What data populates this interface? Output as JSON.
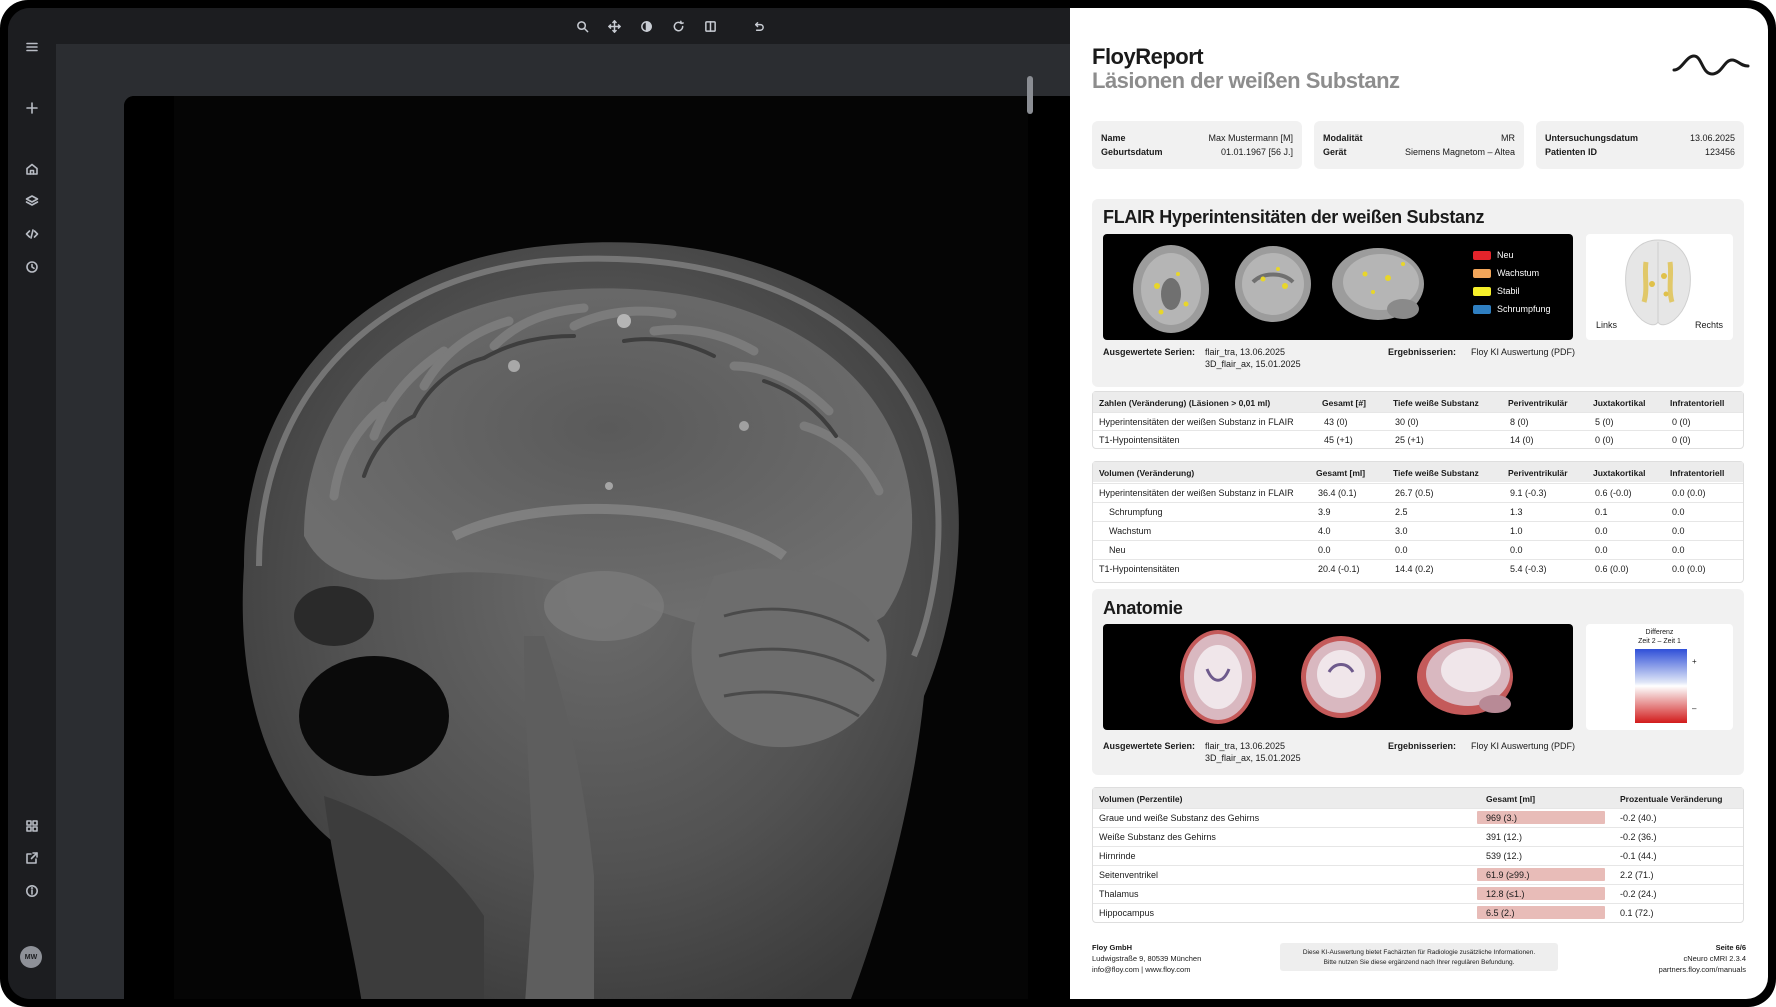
{
  "user": {
    "initials": "MW"
  },
  "viewer": {
    "tools": [
      "search-icon",
      "move-icon",
      "contrast-icon",
      "rotate-icon",
      "split-view-icon",
      "undo-icon"
    ]
  },
  "report": {
    "title": "FloyReport",
    "subtitle": "Läsionen der weißen Substanz",
    "patient": {
      "name_label": "Name",
      "name_value": "Max Mustermann [M]",
      "dob_label": "Geburtsdatum",
      "dob_value": "01.01.1967 [56 J.]",
      "modality_label": "Modalität",
      "modality_value": "MR",
      "device_label": "Gerät",
      "device_value": "Siemens Magnetom – Altea",
      "date_label": "Untersuchungsdatum",
      "date_value": "13.06.2025",
      "id_label": "Patienten ID",
      "id_value": "123456"
    },
    "flair": {
      "title": "FLAIR Hyperintensitäten der weißen Substanz",
      "legend": [
        {
          "label": "Neu",
          "color": "#e3242b"
        },
        {
          "label": "Wachstum",
          "color": "#f2a65a"
        },
        {
          "label": "Stabil",
          "color": "#f5ef2a"
        },
        {
          "label": "Schrumpfung",
          "color": "#2f7fc1"
        }
      ],
      "left_label": "Links",
      "right_label": "Rechts",
      "series_label": "Ausgewertete Serien:",
      "series_line1": "flair_tra, 13.06.2025",
      "series_line2": "3D_flair_ax, 15.01.2025",
      "results_label": "Ergebnisserien:",
      "results_value": "Floy KI Auswertung (PDF)"
    },
    "counts_table": {
      "headers": [
        "Zahlen (Veränderung) (Läsionen > 0,01 ml)",
        "Gesamt [#]",
        "Tiefe weiße Substanz",
        "Periventrikulär",
        "Juxtakortikal",
        "Infratentoriell"
      ],
      "rows": [
        [
          "Hyperintensitäten der weißen Substanz in FLAIR",
          "43 (0)",
          "30 (0)",
          "8 (0)",
          "5 (0)",
          "0 (0)"
        ],
        [
          "T1-Hypointensitäten",
          "45 (+1)",
          "25 (+1)",
          "14 (0)",
          "0 (0)",
          "0 (0)"
        ]
      ]
    },
    "volume_table": {
      "headers": [
        "Volumen (Veränderung)",
        "Gesamt [ml]",
        "Tiefe weiße Substanz",
        "Periventrikulär",
        "Juxtakortikal",
        "Infratentoriell"
      ],
      "rows": [
        [
          "Hyperintensitäten der weißen Substanz in FLAIR",
          "36.4 (0.1)",
          "26.7 (0.5)",
          "9.1 (-0.3)",
          "0.6 (-0.0)",
          "0.0 (0.0)"
        ],
        [
          "Schrumpfung",
          "3.9",
          "2.5",
          "1.3",
          "0.1",
          "0.0"
        ],
        [
          "Wachstum",
          "4.0",
          "3.0",
          "1.0",
          "0.0",
          "0.0"
        ],
        [
          "Neu",
          "0.0",
          "0.0",
          "0.0",
          "0.0",
          "0.0"
        ],
        [
          "T1-Hypointensitäten",
          "20.4 (-0.1)",
          "14.4 (0.2)",
          "5.4 (-0.3)",
          "0.6 (0.0)",
          "0.0 (0.0)"
        ]
      ]
    },
    "anatomy": {
      "title": "Anatomie",
      "diff_title": "Differenz",
      "diff_subtitle": "Zeit 2 – Zeit 1",
      "plus": "+",
      "minus": "–",
      "series_label": "Ausgewertete Serien:",
      "series_line1": "flair_tra, 13.06.2025",
      "series_line2": "3D_flair_ax, 15.01.2025",
      "results_label": "Ergebnisserien:",
      "results_value": "Floy KI Auswertung (PDF)"
    },
    "percentile_table": {
      "headers": [
        "Volumen (Perzentile)",
        "Gesamt [ml]",
        "Prozentuale Veränderung"
      ],
      "rows": [
        [
          "Graue und weiße Substanz des Gehirns",
          "969 (3.)",
          "-0.2 (40.)"
        ],
        [
          "Weiße Substanz des Gehirns",
          "391 (12.)",
          "-0.2 (36.)"
        ],
        [
          "Hirnrinde",
          "539 (12.)",
          "-0.1 (44.)"
        ],
        [
          "Seitenventrikel",
          "61.9 (≥99.)",
          "2.2 (71.)"
        ],
        [
          "Thalamus",
          "12.8 (≤1.)",
          "-0.2 (24.)"
        ],
        [
          "Hippocampus",
          "6.5 (2.)",
          "0.1 (72.)"
        ]
      ],
      "highlighted": [
        0,
        3,
        4,
        5
      ]
    },
    "footer": {
      "company": "Floy GmbH",
      "address": "Ludwigstraße 9, 80539 München",
      "contact": "info@floy.com | www.floy.com",
      "notice_line1": "Diese KI-Auswertung bietet Fachärzten für Radiologie zusätzliche Informationen.",
      "notice_line2": "Bitte nutzen Sie diese ergänzend nach Ihrer regulären Befundung.",
      "page": "Seite 6/6",
      "product": "cNeuro cMRI 2.3.4",
      "manuals": "partners.floy.com/manuals"
    }
  }
}
